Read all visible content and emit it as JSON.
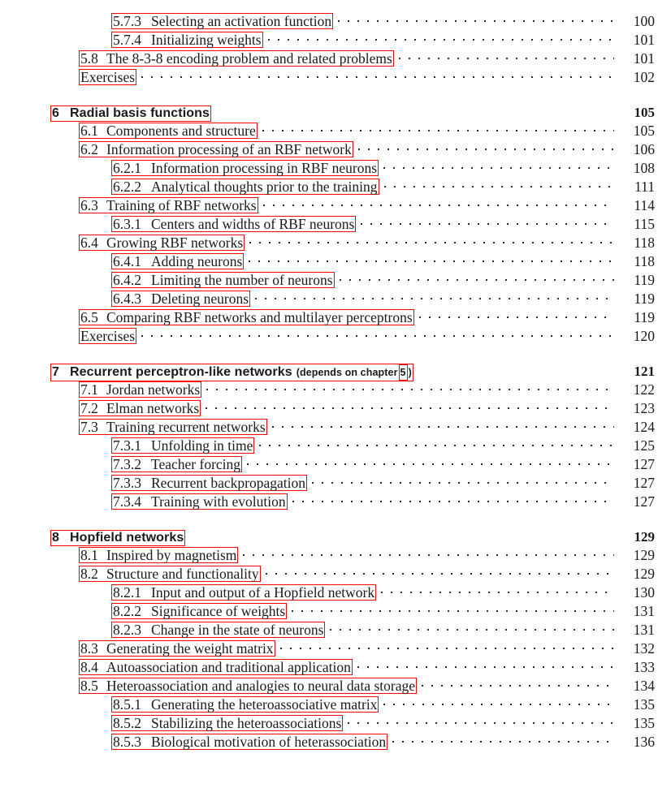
{
  "document": {
    "kind": "table-of-contents",
    "box_color": "#ff0000",
    "text_color": "#1a1a1a"
  },
  "entries": [
    {
      "level": "subsection",
      "number": "5.7.3",
      "title": "Selecting an activation function",
      "page": "100",
      "leader": true,
      "gap_before": false
    },
    {
      "level": "subsection",
      "number": "5.7.4",
      "title": "Initializing weights",
      "page": "101",
      "leader": true,
      "gap_before": false
    },
    {
      "level": "section",
      "number": "5.8",
      "title": "The 8-3-8 encoding problem and related problems",
      "page": "101",
      "leader": true,
      "gap_before": false
    },
    {
      "level": "section",
      "number": "",
      "title": "Exercises",
      "page": "102",
      "leader": true,
      "gap_before": false
    },
    {
      "level": "chapter",
      "number": "6",
      "title": "Radial basis functions",
      "page": "105",
      "leader": false,
      "gap_before": true
    },
    {
      "level": "section",
      "number": "6.1",
      "title": "Components and structure",
      "page": "105",
      "leader": true,
      "gap_before": false
    },
    {
      "level": "section",
      "number": "6.2",
      "title": "Information processing of an RBF network",
      "page": "106",
      "leader": true,
      "gap_before": false
    },
    {
      "level": "subsection",
      "number": "6.2.1",
      "title": "Information processing in RBF neurons",
      "page": "108",
      "leader": true,
      "gap_before": false
    },
    {
      "level": "subsection",
      "number": "6.2.2",
      "title": "Analytical thoughts prior to the training",
      "page": "111",
      "leader": true,
      "gap_before": false
    },
    {
      "level": "section",
      "number": "6.3",
      "title": "Training of RBF networks",
      "page": "114",
      "leader": true,
      "gap_before": false
    },
    {
      "level": "subsection",
      "number": "6.3.1",
      "title": "Centers and widths of RBF neurons",
      "page": "115",
      "leader": true,
      "gap_before": false
    },
    {
      "level": "section",
      "number": "6.4",
      "title": "Growing RBF networks",
      "page": "118",
      "leader": true,
      "gap_before": false
    },
    {
      "level": "subsection",
      "number": "6.4.1",
      "title": "Adding neurons",
      "page": "118",
      "leader": true,
      "gap_before": false
    },
    {
      "level": "subsection",
      "number": "6.4.2",
      "title": "Limiting the number of neurons",
      "page": "119",
      "leader": true,
      "gap_before": false
    },
    {
      "level": "subsection",
      "number": "6.4.3",
      "title": "Deleting neurons",
      "page": "119",
      "leader": true,
      "gap_before": false
    },
    {
      "level": "section",
      "number": "6.5",
      "title": "Comparing RBF networks and multilayer perceptrons",
      "page": "119",
      "leader": true,
      "gap_before": false
    },
    {
      "level": "section",
      "number": "",
      "title": "Exercises",
      "page": "120",
      "leader": true,
      "gap_before": false
    },
    {
      "level": "chapter",
      "number": "7",
      "title": "Recurrent perceptron-like networks",
      "page": "121",
      "leader": false,
      "gap_before": true,
      "note": {
        "prefix": "(depends on chapter",
        "ref": "5",
        "suffix": ")"
      }
    },
    {
      "level": "section",
      "number": "7.1",
      "title": "Jordan networks",
      "page": "122",
      "leader": true,
      "gap_before": false
    },
    {
      "level": "section",
      "number": "7.2",
      "title": "Elman networks",
      "page": "123",
      "leader": true,
      "gap_before": false
    },
    {
      "level": "section",
      "number": "7.3",
      "title": "Training recurrent networks",
      "page": "124",
      "leader": true,
      "gap_before": false
    },
    {
      "level": "subsection",
      "number": "7.3.1",
      "title": "Unfolding in time",
      "page": "125",
      "leader": true,
      "gap_before": false
    },
    {
      "level": "subsection",
      "number": "7.3.2",
      "title": "Teacher forcing",
      "page": "127",
      "leader": true,
      "gap_before": false
    },
    {
      "level": "subsection",
      "number": "7.3.3",
      "title": "Recurrent backpropagation",
      "page": "127",
      "leader": true,
      "gap_before": false
    },
    {
      "level": "subsection",
      "number": "7.3.4",
      "title": "Training with evolution",
      "page": "127",
      "leader": true,
      "gap_before": false
    },
    {
      "level": "chapter",
      "number": "8",
      "title": "Hopfield networks",
      "page": "129",
      "leader": false,
      "gap_before": true
    },
    {
      "level": "section",
      "number": "8.1",
      "title": "Inspired by magnetism",
      "page": "129",
      "leader": true,
      "gap_before": false
    },
    {
      "level": "section",
      "number": "8.2",
      "title": "Structure and functionality",
      "page": "129",
      "leader": true,
      "gap_before": false
    },
    {
      "level": "subsection",
      "number": "8.2.1",
      "title": "Input and output of a Hopfield network",
      "page": "130",
      "leader": true,
      "gap_before": false
    },
    {
      "level": "subsection",
      "number": "8.2.2",
      "title": "Significance of weights",
      "page": "131",
      "leader": true,
      "gap_before": false
    },
    {
      "level": "subsection",
      "number": "8.2.3",
      "title": "Change in the state of neurons",
      "page": "131",
      "leader": true,
      "gap_before": false
    },
    {
      "level": "section",
      "number": "8.3",
      "title": "Generating the weight matrix",
      "page": "132",
      "leader": true,
      "gap_before": false
    },
    {
      "level": "section",
      "number": "8.4",
      "title": "Autoassociation and traditional application",
      "page": "133",
      "leader": true,
      "gap_before": false
    },
    {
      "level": "section",
      "number": "8.5",
      "title": "Heteroassociation and analogies to neural data storage",
      "page": "134",
      "leader": true,
      "gap_before": false
    },
    {
      "level": "subsection",
      "number": "8.5.1",
      "title": "Generating the heteroassociative matrix",
      "page": "135",
      "leader": true,
      "gap_before": false
    },
    {
      "level": "subsection",
      "number": "8.5.2",
      "title": "Stabilizing the heteroassociations",
      "page": "135",
      "leader": true,
      "gap_before": false
    },
    {
      "level": "subsection",
      "number": "8.5.3",
      "title": "Biological motivation of heterassociation",
      "page": "136",
      "leader": true,
      "gap_before": false
    }
  ]
}
